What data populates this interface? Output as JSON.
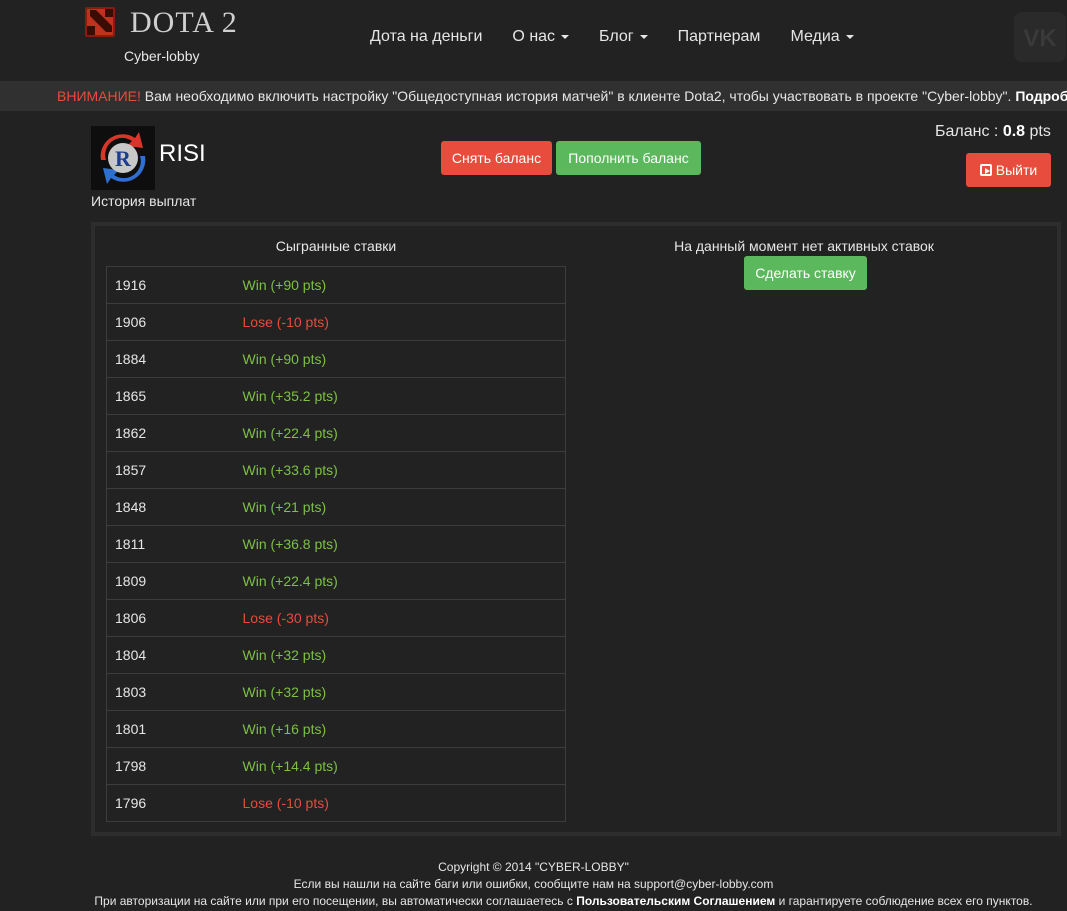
{
  "brand": {
    "title": "DOTA 2",
    "subtitle": "Cyber-lobby"
  },
  "nav": {
    "items": [
      {
        "label": "Дота на деньги",
        "dropdown": false
      },
      {
        "label": "О нас",
        "dropdown": true
      },
      {
        "label": "Блог",
        "dropdown": true
      },
      {
        "label": "Партнерам",
        "dropdown": false
      },
      {
        "label": "Медиа",
        "dropdown": true
      }
    ],
    "vk_icon": "vk-icon"
  },
  "notice": {
    "warning": "ВНИМАНИЕ!",
    "message": " Вам необходимо включить настройку \"Общедоступная история матчей\" в клиенте Dota2, чтобы участвовать в проекте \"Cyber-lobby\". ",
    "more": "Подробно"
  },
  "user": {
    "name": "RISI",
    "payout_history": "История выплат",
    "balance_label": "Баланс",
    "balance_sep": " : ",
    "balance_value": "0.8",
    "balance_unit": " pts"
  },
  "buttons": {
    "withdraw": "Снять баланс",
    "deposit": "Пополнить баланс",
    "logout": "Выйти",
    "make_bet": "Сделать ставку"
  },
  "played": {
    "title": "Сыгранные ставки",
    "rows": [
      {
        "id": "1916",
        "result": "Win (+90 pts)",
        "status": "win"
      },
      {
        "id": "1906",
        "result": "Lose (-10 pts)",
        "status": "lose"
      },
      {
        "id": "1884",
        "result": "Win (+90 pts)",
        "status": "win"
      },
      {
        "id": "1865",
        "result": "Win (+35.2 pts)",
        "status": "win"
      },
      {
        "id": "1862",
        "result": "Win (+22.4 pts)",
        "status": "win"
      },
      {
        "id": "1857",
        "result": "Win (+33.6 pts)",
        "status": "win"
      },
      {
        "id": "1848",
        "result": "Win (+21 pts)",
        "status": "win"
      },
      {
        "id": "1811",
        "result": "Win (+36.8 pts)",
        "status": "win"
      },
      {
        "id": "1809",
        "result": "Win (+22.4 pts)",
        "status": "win"
      },
      {
        "id": "1806",
        "result": "Lose (-30 pts)",
        "status": "lose"
      },
      {
        "id": "1804",
        "result": "Win (+32 pts)",
        "status": "win"
      },
      {
        "id": "1803",
        "result": "Win (+32 pts)",
        "status": "win"
      },
      {
        "id": "1801",
        "result": "Win (+16 pts)",
        "status": "win"
      },
      {
        "id": "1798",
        "result": "Win (+14.4 pts)",
        "status": "win"
      },
      {
        "id": "1796",
        "result": "Lose (-10 pts)",
        "status": "lose"
      }
    ]
  },
  "active": {
    "empty_text": "На данный момент нет активных ставок"
  },
  "footer": {
    "copyright": "Copyright © 2014 \"CYBER-LOBBY\"",
    "bugs": "Если вы нашли на сайте баги или ошибки, сообщите нам на support@cyber-lobby.com",
    "agreement_pre": "При авторизации на сайте или при его посещении, вы автоматически соглашаетесь с ",
    "agreement_link": "Пользовательским Соглашением",
    "agreement_post": " и гарантируете соблюдение всех его пунктов."
  },
  "colors": {
    "background": "#222222",
    "win": "#7cc142",
    "lose": "#e74c3c",
    "button_red": "#e74c3c",
    "button_green": "#5cb85c"
  }
}
